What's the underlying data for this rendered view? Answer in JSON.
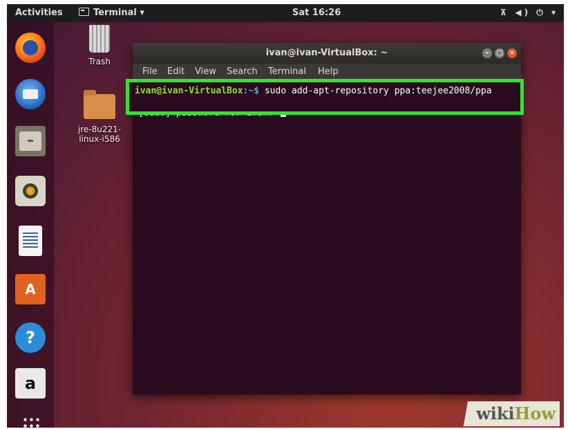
{
  "topbar": {
    "activities": "Activities",
    "app_menu": "Terminal ▾",
    "clock": "Sat 16:26",
    "tray": "⊼ ◀) ⏻ ▾"
  },
  "desktop": {
    "trash_label": "Trash",
    "folder_label": "jre-8u221-linux-i586"
  },
  "dock": {
    "software_glyph": "A",
    "help_glyph": "?",
    "amazon_glyph": "a"
  },
  "terminal": {
    "title": "ivan@ivan-VirtualBox: ~",
    "menu": [
      "File",
      "Edit",
      "View",
      "Search",
      "Terminal",
      "Help"
    ],
    "prompt_user": "ivan@ivan-VirtualBox",
    "prompt_path": ":~$",
    "command": " sudo add-apt-repository ppa:teejee2008/ppa",
    "password_prompt": "[sudo] password for ivan: "
  },
  "watermark": {
    "wiki": "wiki",
    "how": "How"
  },
  "colors": {
    "highlight": "#2ee62c",
    "ubuntu_orange": "#e95420",
    "terminal_bg": "#2c0a20"
  }
}
